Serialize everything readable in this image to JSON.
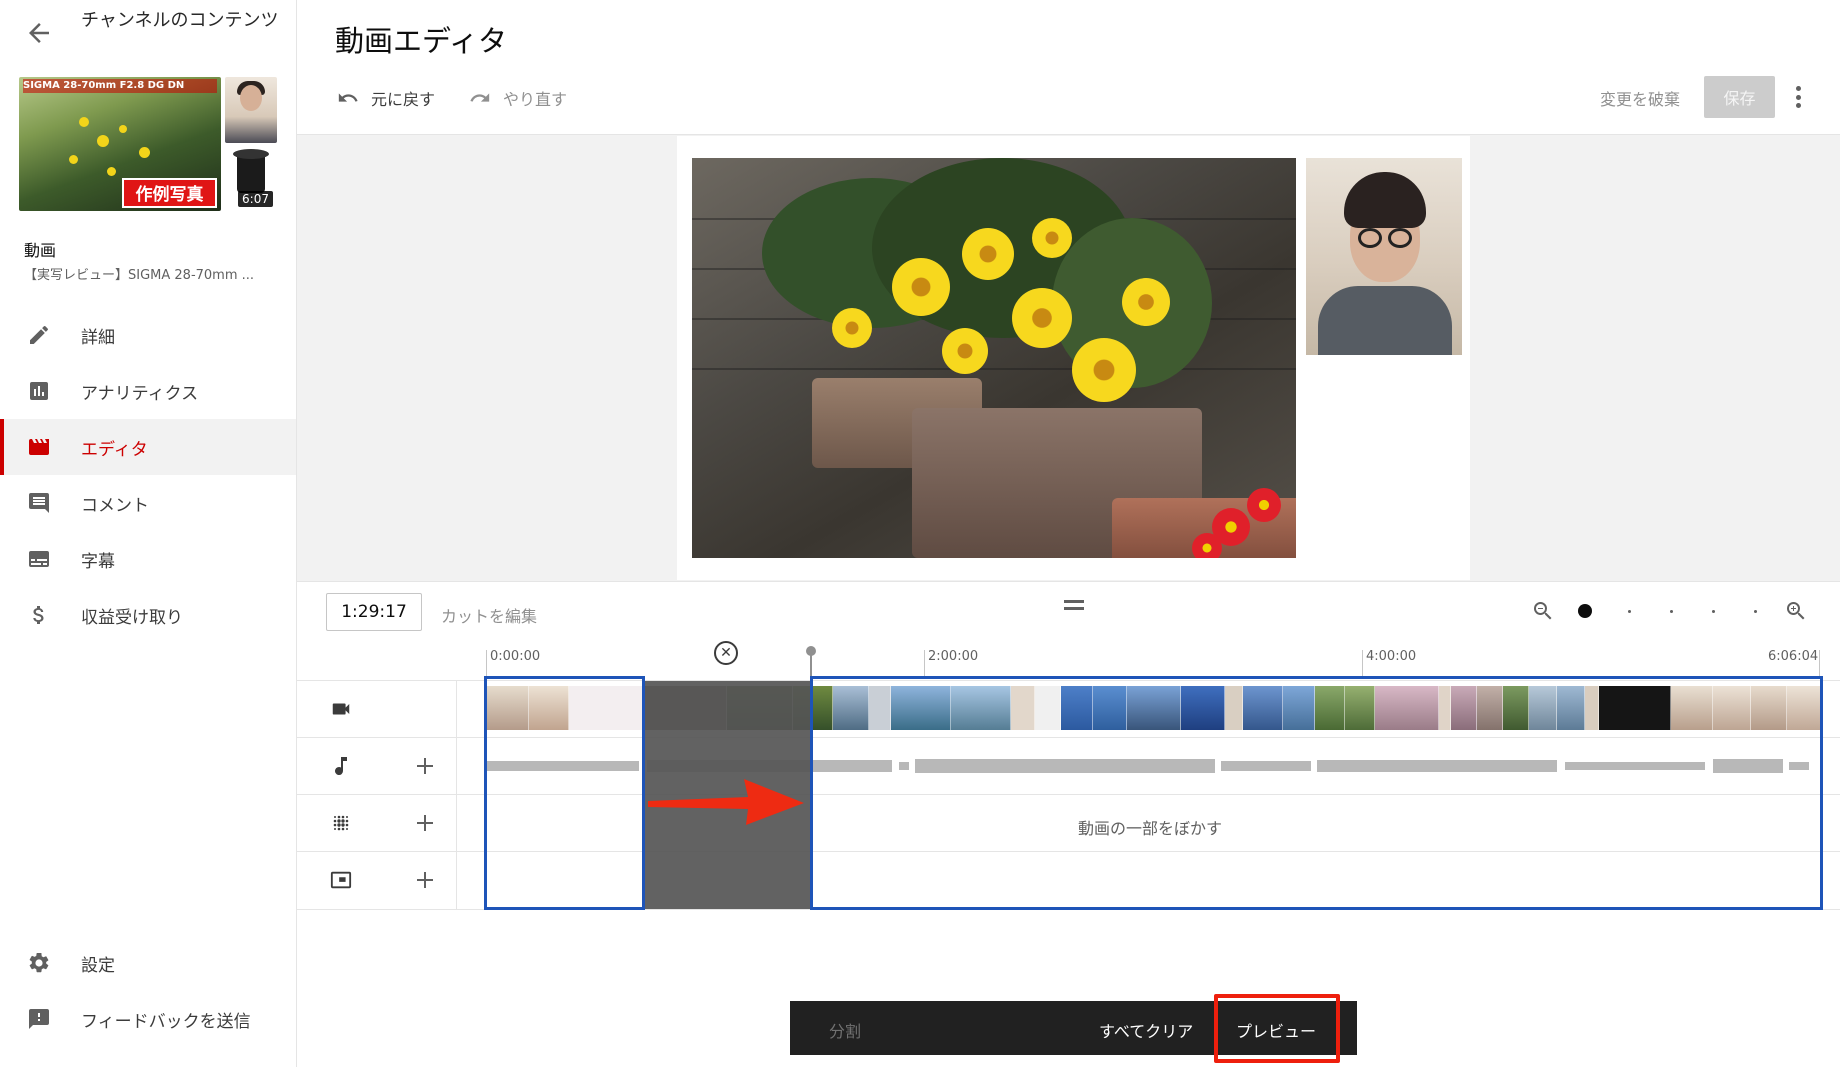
{
  "sidebar": {
    "back_label": "back",
    "channel_title": "チャンネルのコンテンツ",
    "thumbnail": {
      "title_text": "SIGMA 28-70mm F2.8 DG DN",
      "badge_text": "作例写真",
      "duration": "6:07"
    },
    "video_label": "動画",
    "video_title": "【実写レビュー】SIGMA 28-70mm ...",
    "nav_items": [
      {
        "label": "詳細",
        "icon": "pencil-icon"
      },
      {
        "label": "アナリティクス",
        "icon": "analytics-icon"
      },
      {
        "label": "エディタ",
        "icon": "editor-icon",
        "active": true
      },
      {
        "label": "コメント",
        "icon": "comment-icon"
      },
      {
        "label": "字幕",
        "icon": "subtitles-icon"
      },
      {
        "label": "収益受け取り",
        "icon": "dollar-icon"
      }
    ],
    "bottom_items": [
      {
        "label": "設定",
        "icon": "gear-icon"
      },
      {
        "label": "フィードバックを送信",
        "icon": "feedback-icon"
      }
    ]
  },
  "header": {
    "title": "動画エディタ",
    "undo_label": "元に戻す",
    "redo_label": "やり直す",
    "discard_label": "変更を破棄",
    "save_label": "保存"
  },
  "timeline": {
    "current_time": "1:29:17",
    "edit_cut_label": "カットを編集",
    "ruler": [
      "0:00:00",
      "2:00:00",
      "4:00:00",
      "6:06:04"
    ],
    "blur_label": "動画の一部をぼかす",
    "zoom_level_fraction": 0
  },
  "bottom_bar": {
    "split_label": "分割",
    "clear_all_label": "すべてクリア",
    "preview_label": "プレビュー"
  },
  "colors": {
    "accent_red": "#cc0000",
    "selection_blue": "#1e54b8",
    "highlight_red": "#ee1f0d"
  }
}
